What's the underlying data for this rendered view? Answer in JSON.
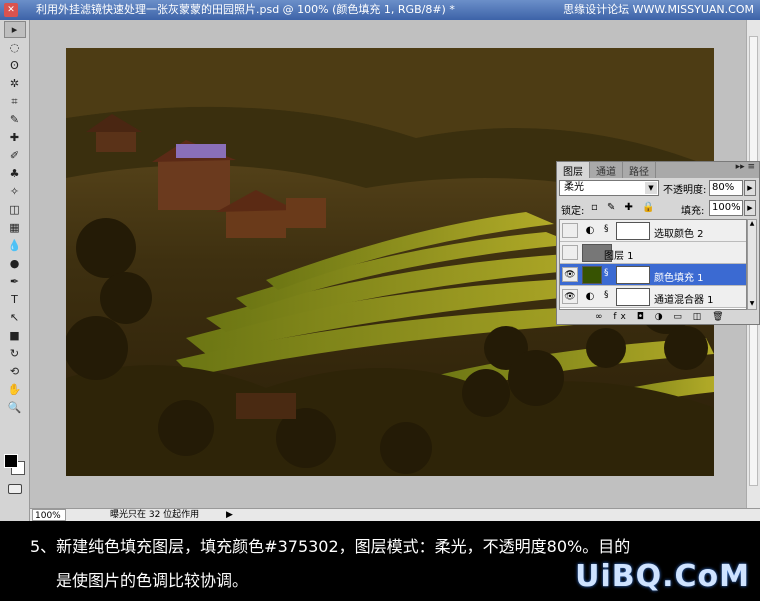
{
  "window": {
    "title": "利用外挂滤镜快速处理一张灰蒙蒙的田园照片.psd @ 100% (颜色填充 1, RGB/8#) *",
    "watermark": "思缘设计论坛 WWW.MISSYUAN.COM"
  },
  "toolbar": {
    "tools": [
      "move-icon",
      "marquee-icon",
      "lasso-icon",
      "magic-wand-icon",
      "crop-icon",
      "eyedropper-icon",
      "healing-brush-icon",
      "brush-icon",
      "clone-stamp-icon",
      "history-brush-icon",
      "eraser-icon",
      "gradient-icon",
      "blur-icon",
      "dodge-icon",
      "pen-icon",
      "type-icon",
      "path-select-icon",
      "shape-icon",
      "3d-rotate-icon",
      "3d-orbit-icon",
      "hand-icon",
      "zoom-icon"
    ],
    "glyphs": [
      "▸",
      "◌",
      "ʘ",
      "✲",
      "⌗",
      "✎",
      "✚",
      "✐",
      "♣",
      "✧",
      "◫",
      "▦",
      "💧",
      "●",
      "✒",
      "T",
      "↖",
      "■",
      "↻",
      "⟲",
      "✋",
      "🔍"
    ]
  },
  "status": {
    "zoom": "100%",
    "info": "曝光只在 32 位起作用",
    "arrow": "▶"
  },
  "layers_panel": {
    "tabs": [
      "图层",
      "通道",
      "路径"
    ],
    "active_tab": 0,
    "menu_glyph": "▸▸ ≡",
    "blend_mode": "柔光",
    "opacity_label": "不透明度:",
    "opacity": "80%",
    "lock_label": "锁定:",
    "lock_icons": "▫ ✎ ✚ 🔒",
    "fill_label": "填充:",
    "fill": "100%",
    "layers": [
      {
        "name": "选取颜色 2",
        "type": "adjustment",
        "visible": false,
        "selected": false
      },
      {
        "name": "图层 1",
        "type": "pixel",
        "visible": false,
        "selected": false
      },
      {
        "name": "颜色填充 1",
        "type": "fill",
        "visible": true,
        "selected": true,
        "color": "#375302"
      },
      {
        "name": "通道混合器 1",
        "type": "adjustment",
        "visible": true,
        "selected": false
      }
    ],
    "footer_icons": "∞ fx ◘ ◑ ▭ ◫ 🗑"
  },
  "caption": {
    "line1": "5、新建纯色填充图层，填充颜色#375302，图层模式：柔光，不透明度80%。目的",
    "line2": "是使图片的色调比较协调。",
    "logo": "UiBQ.CoM"
  }
}
